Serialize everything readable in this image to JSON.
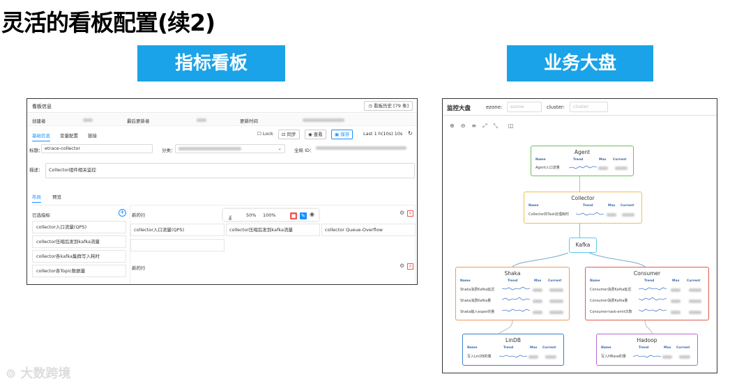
{
  "slide": {
    "title": "灵活的看板配置(续2)"
  },
  "banners": {
    "left": "指标看板",
    "right": "业务大盘"
  },
  "board": {
    "title": "看板信息",
    "history_btn": "看板历史 [79 条]",
    "info": {
      "creator_label": "创建者",
      "updater_label": "最后更新者",
      "updated_label": "更新时间"
    },
    "tabs": [
      "基础信息",
      "变量配置",
      "链接"
    ],
    "toolbar": {
      "lock": "Lock",
      "sync": "同步",
      "view": "查看",
      "save": "保存",
      "range": "Last 1 h(10s) 10s"
    },
    "fields": {
      "title_label": "标题：",
      "title_value": "etrace-collector",
      "category_label": "分类：",
      "global_id_label": "全局 ID：",
      "desc_label": "描述：",
      "desc_value": "Collector组件相关监控"
    },
    "layout_tabs": [
      "布局",
      "预览"
    ],
    "selected_header": "已选指标",
    "selected_metrics": [
      "collector入口流量(QPS)",
      "collector压缩后发到kafka流量",
      "collector各kafka集群写入耗时",
      "collector各Topic数据量"
    ],
    "row_label": "新的行",
    "row_toolbar": {
      "span": "8",
      "w1": "50%",
      "w2": "100%"
    },
    "row_cells": [
      "collector入口流量(QPS)",
      "collector压缩后发到kafka流量",
      "collector Queue-Overflow"
    ],
    "row2_label": "新的行"
  },
  "dashboard": {
    "title": "监控大盘",
    "ezone_label": "ezone:",
    "ezone_placeholder": "ezone",
    "cluster_label": "cluster:",
    "cluster_placeholder": "cluster",
    "col_headers": {
      "name": "Name",
      "trend": "Trend",
      "max": "Max",
      "current": "Current"
    },
    "nodes": {
      "agent": {
        "name": "Agent",
        "metrics": [
          "Agent入口流量"
        ]
      },
      "collector": {
        "name": "Collector",
        "metrics": [
          "Collector的Task处理耗时"
        ]
      },
      "kafka": {
        "name": "Kafka"
      },
      "shaka": {
        "name": "Shaka",
        "metrics": [
          "Shaka消费Kafka延迟",
          "Shaka消费Kafka量",
          "Shaka输入esper的量"
        ]
      },
      "consumer": {
        "name": "Consumer",
        "metrics": [
          "Consumer消费Kafka延迟",
          "Consumer消费Kafka量",
          "Consumer-task-emit次数"
        ]
      },
      "lindb": {
        "name": "LinDB",
        "metrics": [
          "写入LinDB的量"
        ]
      },
      "hadoop": {
        "name": "Hadoop",
        "metrics": [
          "写入HBase的量"
        ]
      }
    },
    "colors": {
      "agent": "#6cbf5c",
      "collector": "#f0c04a",
      "kafka": "#5bc8ea",
      "shaka": "#ee9a5a",
      "consumer": "#e05a4e",
      "lindb": "#3a7fd0",
      "hadoop": "#b468d2"
    }
  },
  "watermark": "大数跨境"
}
